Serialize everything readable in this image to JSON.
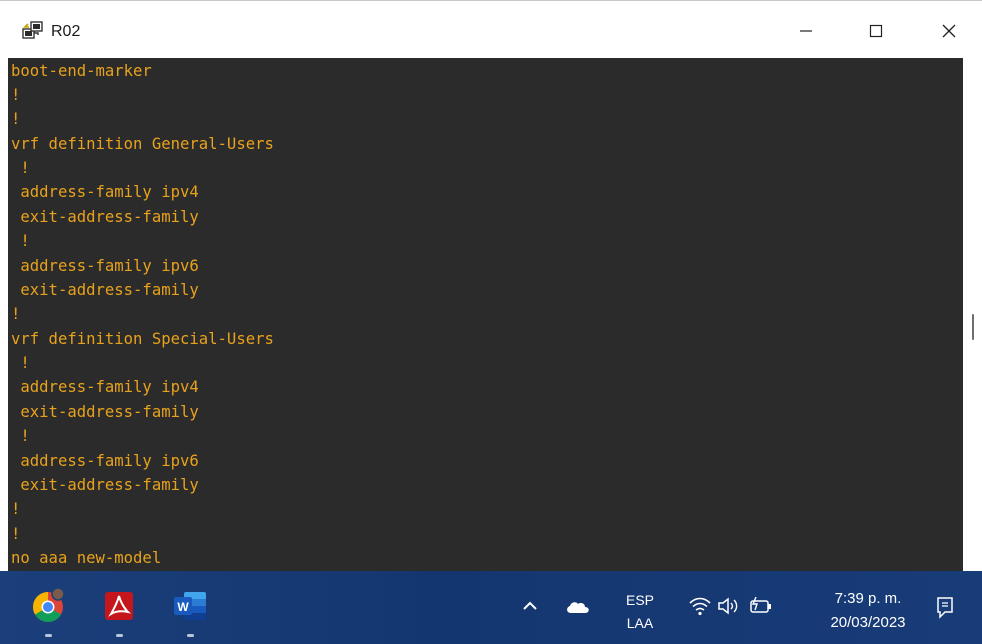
{
  "window": {
    "title": "R02",
    "controls": {
      "minimize_icon": "minimize-icon",
      "maximize_icon": "maximize-icon",
      "close_icon": "close-icon"
    }
  },
  "terminal": {
    "lines": [
      "boot-end-marker",
      "!",
      "!",
      "vrf definition General-Users",
      " !",
      " address-family ipv4",
      " exit-address-family",
      " !",
      " address-family ipv6",
      " exit-address-family",
      "!",
      "vrf definition Special-Users",
      " !",
      " address-family ipv4",
      " exit-address-family",
      " !",
      " address-family ipv6",
      " exit-address-family",
      "!",
      "!",
      "no aaa new-model"
    ],
    "colors": {
      "background": "#2b2b2b",
      "text": "#e8a21c"
    }
  },
  "taskbar": {
    "apps": [
      {
        "name": "chrome",
        "icon": "chrome-icon"
      },
      {
        "name": "adobe-acrobat",
        "icon": "acrobat-icon"
      },
      {
        "name": "word",
        "icon": "word-icon"
      }
    ],
    "tray": {
      "chevron_icon": "chevron-up-icon",
      "cloud_icon": "onedrive-icon",
      "language": {
        "line1": "ESP",
        "line2": "LAA"
      },
      "wifi_icon": "wifi-icon",
      "volume_icon": "speaker-icon",
      "battery_icon": "battery-icon",
      "time": "7:39 p. m.",
      "date": "20/03/2023",
      "notification_icon": "notification-icon"
    }
  }
}
